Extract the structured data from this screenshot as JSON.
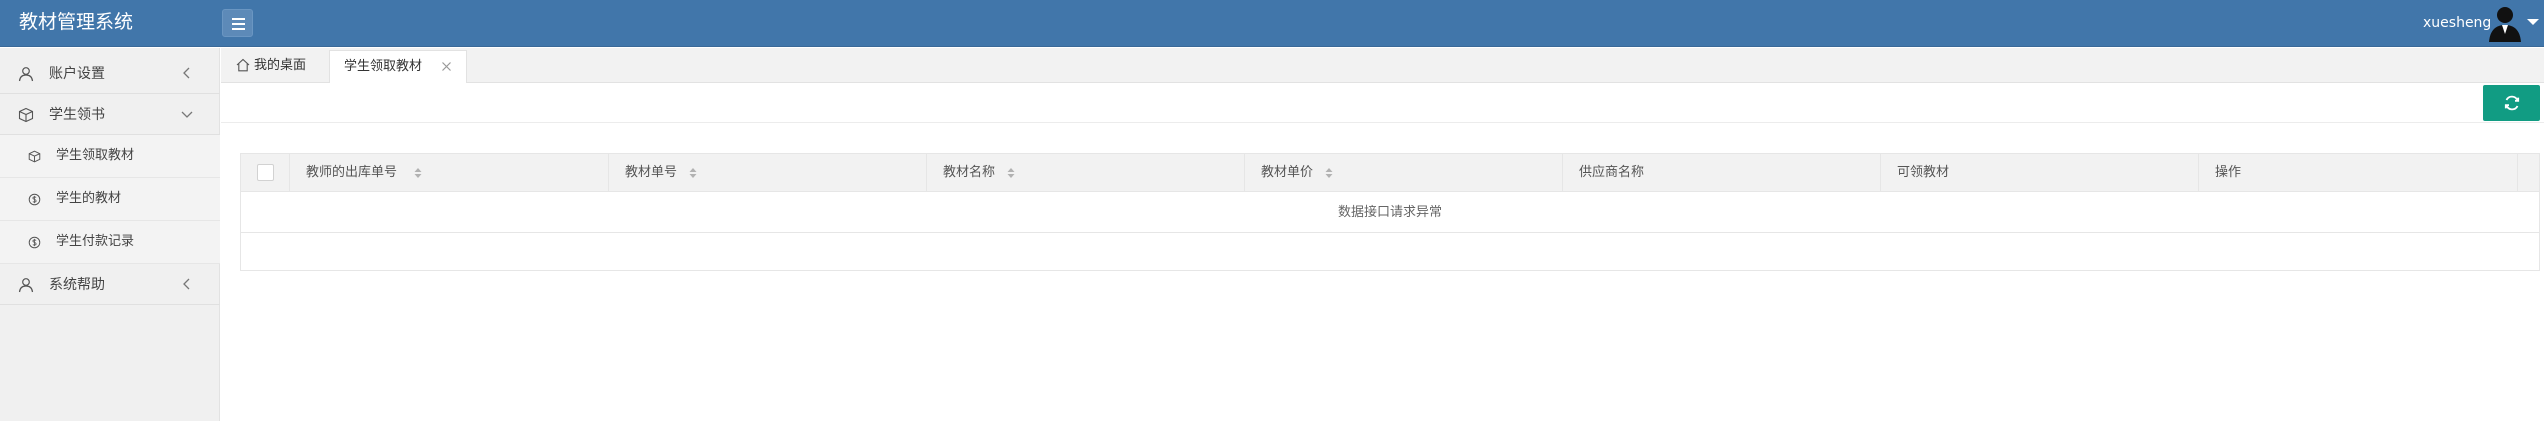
{
  "header": {
    "app_title": "教材管理系统",
    "user_name": "xuesheng",
    "colors": {
      "bar": "#4176aa",
      "accent_button": "#119c83"
    }
  },
  "sidebar": {
    "items": [
      {
        "label": "账户设置",
        "icon": "user-icon",
        "expanded": false
      },
      {
        "label": "学生领书",
        "icon": "box-icon",
        "expanded": true
      },
      {
        "label": "学生领取教材",
        "icon": "box-icon"
      },
      {
        "label": "学生的教材",
        "icon": "coin-icon"
      },
      {
        "label": "学生付款记录",
        "icon": "coin-icon"
      },
      {
        "label": "系统帮助",
        "icon": "user-icon",
        "expanded": false
      }
    ]
  },
  "tabs": [
    {
      "label": "我的桌面",
      "icon": "home-icon"
    },
    {
      "label": "学生领取教材",
      "active": true,
      "closable": true
    }
  ],
  "toolbar": {
    "refresh_icon": "refresh-icon"
  },
  "table": {
    "columns": [
      "教师的出库单号",
      "教材单号",
      "教材名称",
      "教材单价",
      "供应商名称",
      "可领教材",
      "操作"
    ],
    "sortable": [
      true,
      true,
      true,
      true,
      false,
      false,
      false
    ],
    "empty_message": "数据接口请求异常"
  }
}
